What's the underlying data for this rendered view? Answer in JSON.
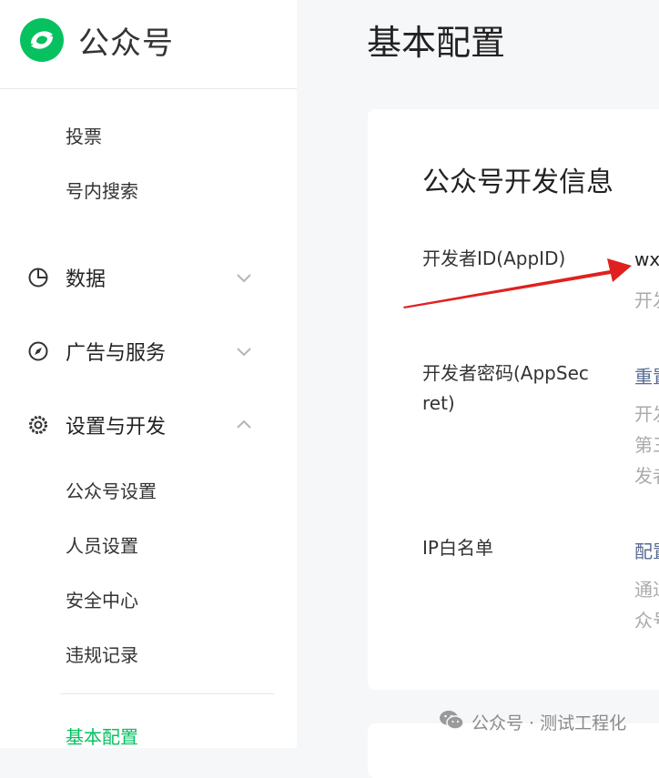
{
  "brand": {
    "name": "公众号"
  },
  "page": {
    "title": "基本配置"
  },
  "sidebar": {
    "top_items": [
      "投票",
      "号内搜索"
    ],
    "groups": [
      {
        "label": "数据",
        "icon": "pie-chart-icon",
        "expanded": false
      },
      {
        "label": "广告与服务",
        "icon": "compass-icon",
        "expanded": false
      },
      {
        "label": "设置与开发",
        "icon": "gear-icon",
        "expanded": true
      }
    ],
    "settings_items": [
      "公众号设置",
      "人员设置",
      "安全中心",
      "违规记录"
    ],
    "active_item": "基本配置"
  },
  "card": {
    "title": "公众号开发信息",
    "rows": [
      {
        "label": "开发者ID(AppID)",
        "value": "wx",
        "hints": [
          "开发"
        ]
      },
      {
        "label": "开发者密码(AppSecret)",
        "label_lines": [
          "开发者密码(AppSec",
          "ret)"
        ],
        "value": "重置",
        "hints": [
          "开发",
          "第三",
          "发者"
        ]
      },
      {
        "label": "IP白名单",
        "value": "配置",
        "hints": [
          "通过",
          "众号"
        ]
      }
    ]
  },
  "annotation": {
    "color": "#e02020"
  },
  "watermark": {
    "text": "公众号 · 测试工程化"
  },
  "colors": {
    "accent": "#07c160",
    "link": "#576b95"
  }
}
